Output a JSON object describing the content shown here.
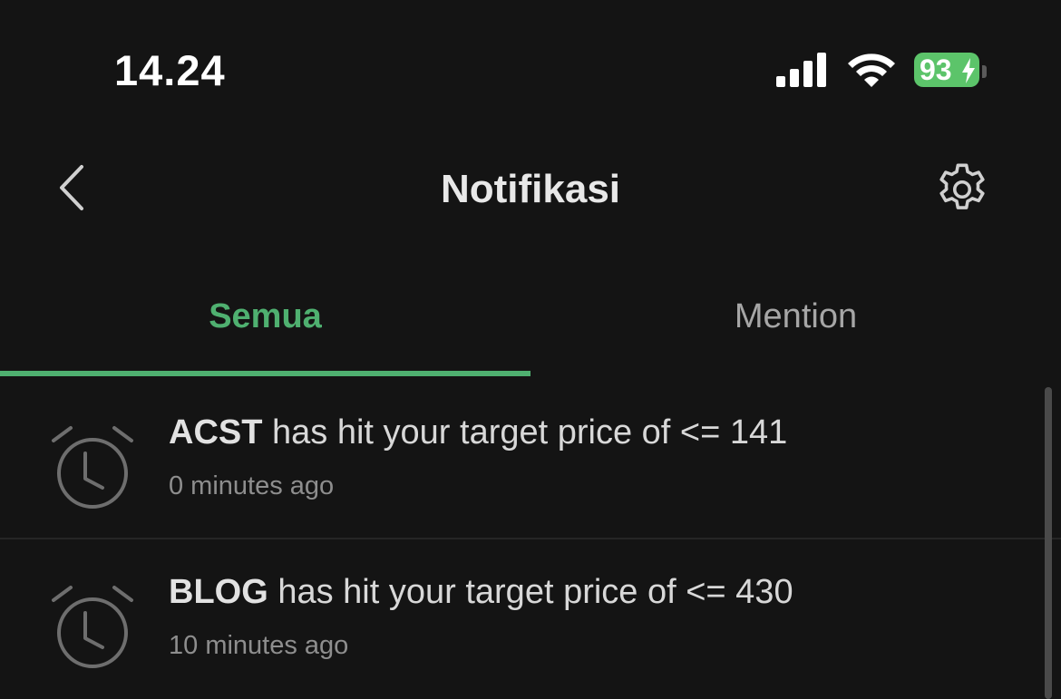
{
  "status_bar": {
    "time": "14.24",
    "battery_level": "93",
    "battery_charging": true,
    "signal_bars": 4,
    "icons": [
      "signal-icon",
      "wifi-icon",
      "battery-icon",
      "charging-bolt-icon"
    ]
  },
  "header": {
    "title": "Notifikasi",
    "back_icon": "chevron-left-icon",
    "settings_icon": "gear-icon"
  },
  "tabs": [
    {
      "label": "Semua",
      "active": true
    },
    {
      "label": "Mention",
      "active": false
    }
  ],
  "notifications": [
    {
      "ticker": "ACST",
      "message": " has hit your target price of <= 141",
      "time": "0 minutes ago",
      "icon": "alarm-clock-icon"
    },
    {
      "ticker": "BLOG",
      "message": " has hit your target price of <= 430",
      "time": "10 minutes ago",
      "icon": "alarm-clock-icon"
    }
  ],
  "colors": {
    "background": "#141414",
    "accent": "#4fb070",
    "battery": "#5cc46a",
    "muted_text": "#8e8e8e"
  }
}
